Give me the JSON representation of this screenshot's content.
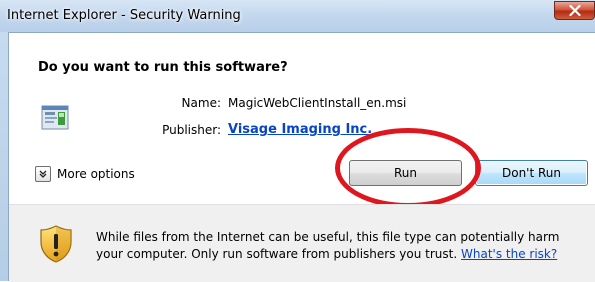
{
  "window": {
    "title": "Internet Explorer - Security Warning",
    "close_icon": "close-icon"
  },
  "dialog": {
    "question": "Do you want to run this software?",
    "file_icon": "installer-file-icon",
    "name_label": "Name:",
    "name_value": "MagicWebClientInstall_en.msi",
    "publisher_label": "Publisher:",
    "publisher_value": "Visage Imaging Inc.",
    "more_options_label": "More options",
    "more_options_icon": "chevron-down-icon",
    "run_label": "Run",
    "dont_run_label": "Don't Run",
    "highlight_color": "#e0161e"
  },
  "warning": {
    "icon": "shield-warning-icon",
    "text": "While files from the Internet can be useful, this file type can potentially harm your computer. Only run software from publishers you trust.",
    "link": "What's the risk?"
  },
  "colors": {
    "link": "#0645c8",
    "title_bar": "#c4d8ee",
    "close_button": "#d0543b"
  }
}
